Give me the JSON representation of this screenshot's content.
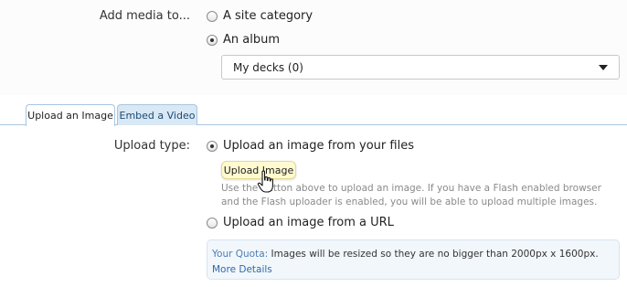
{
  "media_target": {
    "label": "Add media to...",
    "options": [
      {
        "label": "A site category",
        "selected": false
      },
      {
        "label": "An album",
        "selected": true
      }
    ],
    "album_select": {
      "value": "My decks (0)"
    }
  },
  "tabs": [
    {
      "label": "Upload an Image",
      "active": true
    },
    {
      "label": "Embed a Video",
      "active": false
    }
  ],
  "upload": {
    "type_label": "Upload type:",
    "options": [
      {
        "label": "Upload an image from your files",
        "selected": true
      },
      {
        "label": "Upload an image from a URL",
        "selected": false
      }
    ],
    "button_label": "Upload Image",
    "hint_text": "Use the button above to upload an image. If you have a Flash enabled browser and the Flash uploader is enabled, you will be able to upload multiple images."
  },
  "quota": {
    "label": "Your Quota:",
    "text": " Images will be resized so they are no bigger than 2000px x 1600px. ",
    "link_label": "More Details"
  },
  "colors": {
    "tab_border": "#a9c5e0",
    "tab_inactive_bg": "#d9e8f5",
    "button_bg": "#fffad0",
    "quota_bg": "#f2f7fc",
    "link": "#2f6aa8"
  },
  "icons": [
    "hand-pointer-cursor-icon",
    "dropdown-caret-icon"
  ]
}
